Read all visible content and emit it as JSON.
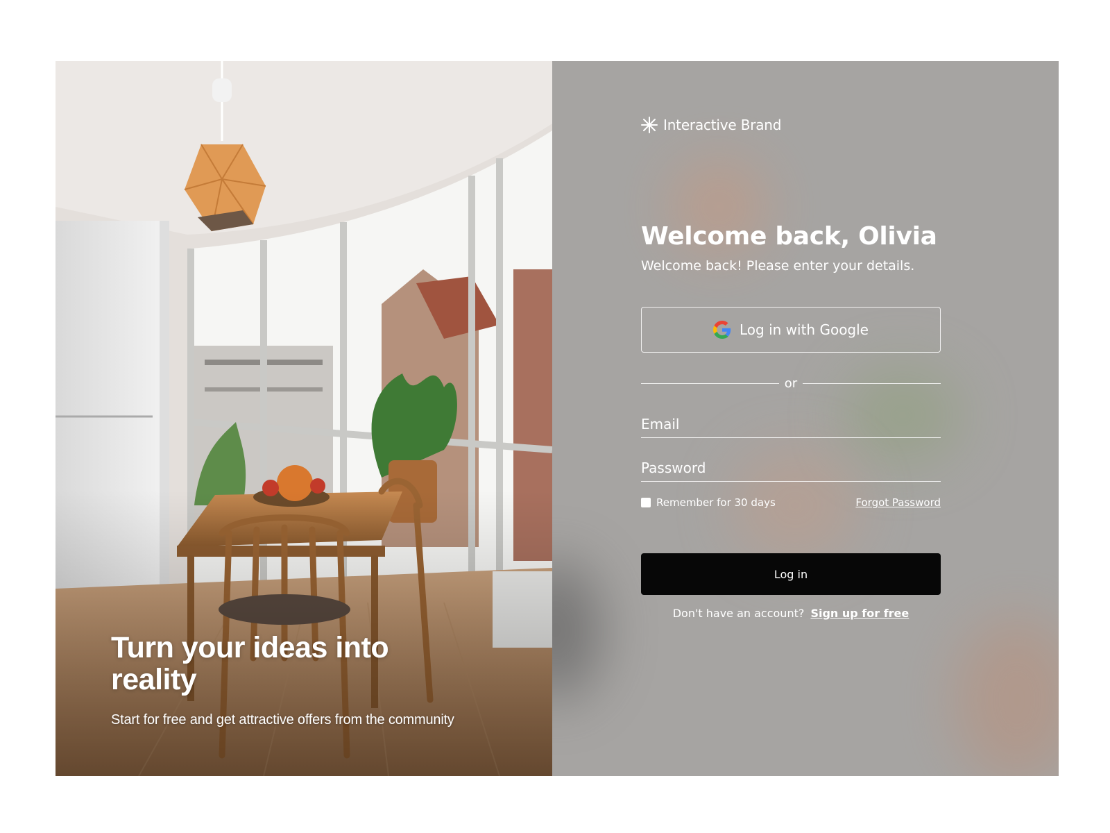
{
  "hero": {
    "title": "Turn your ideas into reality",
    "subtitle": "Start for free and get attractive offers from the community"
  },
  "brand": {
    "name": "Interactive Brand",
    "icon": "asterisk-logo-icon"
  },
  "form": {
    "heading": "Welcome back, Olivia",
    "subheading": "Welcome back! Please enter your details.",
    "google_button": "Log in with Google",
    "divider": "or",
    "email_placeholder": "Email",
    "password_placeholder": "Password",
    "remember_label": "Remember for 30 days",
    "forgot_link": "Forgot Password",
    "login_button": "Log in",
    "signup_prompt": "Don't have an account?",
    "signup_link": "Sign up for free"
  },
  "colors": {
    "panel_bg": "#a6a4a2",
    "button_bg": "#070707",
    "text": "#ffffff"
  }
}
